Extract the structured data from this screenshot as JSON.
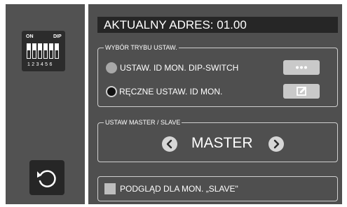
{
  "sidebar": {
    "dip_icon": {
      "on_label": "ON",
      "dip_label": "DIP",
      "numbers": "123456"
    },
    "back_button_icon": "rotate-ccw-icon"
  },
  "header": {
    "title": "AKTUALNY ADRES: 01.00"
  },
  "mode_group": {
    "legend": "WYBÓR TRYBU USTAW.",
    "options": [
      {
        "label": "USTAW. ID MON. DIP-SWITCH",
        "selected": false,
        "button_icon": "ellipsis-icon"
      },
      {
        "label": "RĘCZNE USTAW. ID MON.",
        "selected": true,
        "button_icon": "edit-icon"
      }
    ]
  },
  "master_group": {
    "legend": "USTAW MASTER / SLAVE",
    "value": "MASTER"
  },
  "preview": {
    "label": "PODGLĄD DLA MON. „SLAVE\"",
    "checked": false
  },
  "colors": {
    "panel": "#4f4f4f",
    "sidebar": "#525252",
    "title_bar": "#262626"
  }
}
